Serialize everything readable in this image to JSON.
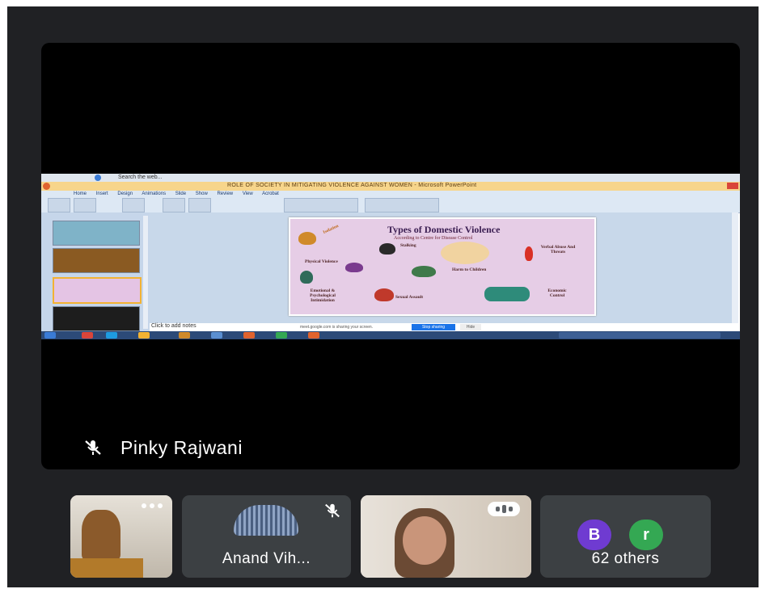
{
  "shared_screen": {
    "browser_search": "Search the web...",
    "window_title": "ROLE OF SOCIETY IN MITIGATING VIOLENCE AGAINST WOMEN - Microsoft PowerPoint",
    "ribbon_tabs": [
      "Home",
      "Insert",
      "Design",
      "Animations",
      "Slide Show",
      "Review",
      "View",
      "Acrobat"
    ],
    "slide": {
      "title": "Types of Domestic Violence",
      "subtitle": "According to Centre for Disease Control",
      "labels": {
        "isolation": "Isolation",
        "stalking": "Stalking",
        "verbal": "Verbal Abuse And Threats",
        "physical": "Physical Violence",
        "children": "Harm to Children",
        "emotional": "Emotional & Psychological Intimidation",
        "sexual": "Sexual Assault",
        "economic": "Economic Control"
      }
    },
    "notes_placeholder": "Click to add notes",
    "share_banner_text": "meet.google.com is sharing your screen.",
    "stop_sharing": "Stop sharing",
    "hide": "Hide"
  },
  "speaker": {
    "name": "Pinky Rajwani"
  },
  "participants": [
    {
      "name": ""
    },
    {
      "name": "Anand Vih..."
    },
    {
      "name": ""
    }
  ],
  "others": {
    "avatars": [
      {
        "initial": "B",
        "color": "#6f3bd1"
      },
      {
        "initial": "r",
        "color": "#34a853"
      }
    ],
    "label": "62 others"
  },
  "colors": {
    "background": "#202124",
    "tile": "#3c4043",
    "accent": "#1a73e8"
  }
}
